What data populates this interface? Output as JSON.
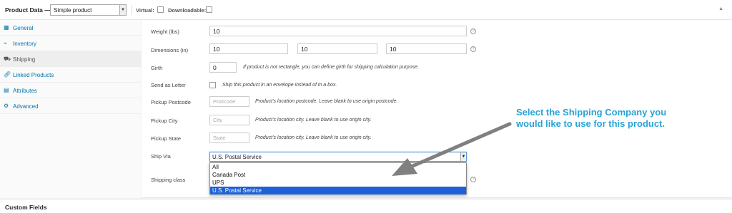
{
  "header": {
    "title": "Product Data —",
    "product_type": "Simple product",
    "virtual_label": "Virtual:",
    "downloadable_label": "Downloadable:"
  },
  "sidebar": {
    "items": [
      {
        "label": "General",
        "icon": "grid-icon"
      },
      {
        "label": "Inventory",
        "icon": "chart-icon"
      },
      {
        "label": "Shipping",
        "icon": "truck-icon"
      },
      {
        "label": "Linked Products",
        "icon": "link-icon"
      },
      {
        "label": "Attributes",
        "icon": "list-icon"
      },
      {
        "label": "Advanced",
        "icon": "gear-icon"
      }
    ],
    "active": "Shipping"
  },
  "fields": {
    "weight": {
      "label": "Weight (lbs)",
      "value": "10"
    },
    "dimensions": {
      "label": "Dimensions (in)",
      "length": "10",
      "width": "10",
      "height": "10"
    },
    "girth": {
      "label": "Girth",
      "value": "0",
      "desc": "If product is not rectangle, you can define girth for shipping calculation purpose."
    },
    "send_as_letter": {
      "label": "Send as Letter",
      "desc": "Ship this product in an envelope instead of in a box."
    },
    "pickup_postcode": {
      "label": "Pickup Postcode",
      "placeholder": "Postcode",
      "desc": "Product's location postcode. Leave blank to use origin postcode."
    },
    "pickup_city": {
      "label": "Pickup City",
      "placeholder": "City",
      "desc": "Product's location city. Leave blank to use origin city."
    },
    "pickup_state": {
      "label": "Pickup State",
      "placeholder": "State",
      "desc": "Product's location city. Leave blank to use origin city."
    },
    "ship_via": {
      "label": "Ship Via",
      "value": "U.S. Postal Service",
      "options": [
        "All",
        "Canada Post",
        "UPS",
        "U.S. Postal Service"
      ]
    },
    "shipping_class": {
      "label": "Shipping class"
    }
  },
  "custom_fields": {
    "title": "Custom Fields"
  },
  "annotation": {
    "text": "Select the Shipping Company you would like to use for this product."
  },
  "colors": {
    "accent": "#0073aa",
    "annotation": "#29a3d6",
    "selected_option": "#1c62d6",
    "arrow": "#808080"
  }
}
